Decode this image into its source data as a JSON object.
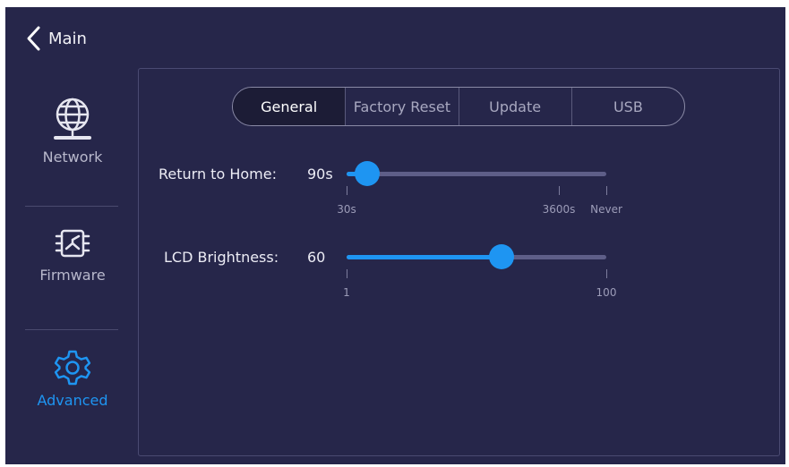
{
  "header": {
    "back_label": "Main"
  },
  "sidebar": {
    "items": [
      {
        "label": "Network",
        "icon": "globe-network-icon",
        "active": false
      },
      {
        "label": "Firmware",
        "icon": "chip-icon",
        "active": false
      },
      {
        "label": "Advanced",
        "icon": "gear-icon",
        "active": true
      }
    ]
  },
  "tabs": [
    {
      "label": "General",
      "active": true
    },
    {
      "label": "Factory Reset",
      "active": false
    },
    {
      "label": "Update",
      "active": false
    },
    {
      "label": "USB",
      "active": false
    }
  ],
  "settings": {
    "return_to_home": {
      "label": "Return to Home:",
      "value": "90s",
      "position_fraction": 0.08,
      "ticks": [
        "30s",
        "3600s",
        "Never"
      ]
    },
    "lcd_brightness": {
      "label": "LCD Brightness:",
      "value": "60",
      "level": 60,
      "min": 1,
      "max": 100,
      "ticks": [
        "1",
        "100"
      ]
    }
  },
  "colors": {
    "accent": "#1e95f2",
    "background": "#26264a",
    "track": "#5e5e88"
  }
}
